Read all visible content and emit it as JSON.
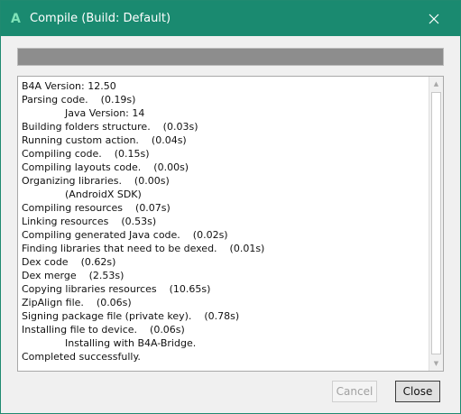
{
  "window": {
    "app_icon_glyph": "A",
    "title": "Compile (Build: Default)",
    "accent_color": "#1a8a70"
  },
  "progress": {
    "value_percent": 100,
    "fill_color": "#8d8d8d"
  },
  "log": {
    "lines": [
      {
        "text": "B4A Version: 12.50",
        "indent": false
      },
      {
        "text": "Parsing code.    (0.19s)",
        "indent": false
      },
      {
        "text": "Java Version: 14",
        "indent": true
      },
      {
        "text": "Building folders structure.    (0.03s)",
        "indent": false
      },
      {
        "text": "Running custom action.    (0.04s)",
        "indent": false
      },
      {
        "text": "Compiling code.    (0.15s)",
        "indent": false
      },
      {
        "text": "Compiling layouts code.    (0.00s)",
        "indent": false
      },
      {
        "text": "Organizing libraries.    (0.00s)",
        "indent": false
      },
      {
        "text": "(AndroidX SDK)",
        "indent": true
      },
      {
        "text": "Compiling resources    (0.07s)",
        "indent": false
      },
      {
        "text": "Linking resources    (0.53s)",
        "indent": false
      },
      {
        "text": "Compiling generated Java code.    (0.02s)",
        "indent": false
      },
      {
        "text": "Finding libraries that need to be dexed.    (0.01s)",
        "indent": false
      },
      {
        "text": "Dex code    (0.62s)",
        "indent": false
      },
      {
        "text": "Dex merge    (2.53s)",
        "indent": false
      },
      {
        "text": "Copying libraries resources    (10.65s)",
        "indent": false
      },
      {
        "text": "ZipAlign file.    (0.06s)",
        "indent": false
      },
      {
        "text": "Signing package file (private key).    (0.78s)",
        "indent": false
      },
      {
        "text": "Installing file to device.    (0.06s)",
        "indent": false
      },
      {
        "text": "Installing with B4A-Bridge.",
        "indent": true
      },
      {
        "text": "Completed successfully.",
        "indent": false
      }
    ]
  },
  "buttons": {
    "cancel_label": "Cancel",
    "cancel_enabled": false,
    "close_label": "Close"
  }
}
